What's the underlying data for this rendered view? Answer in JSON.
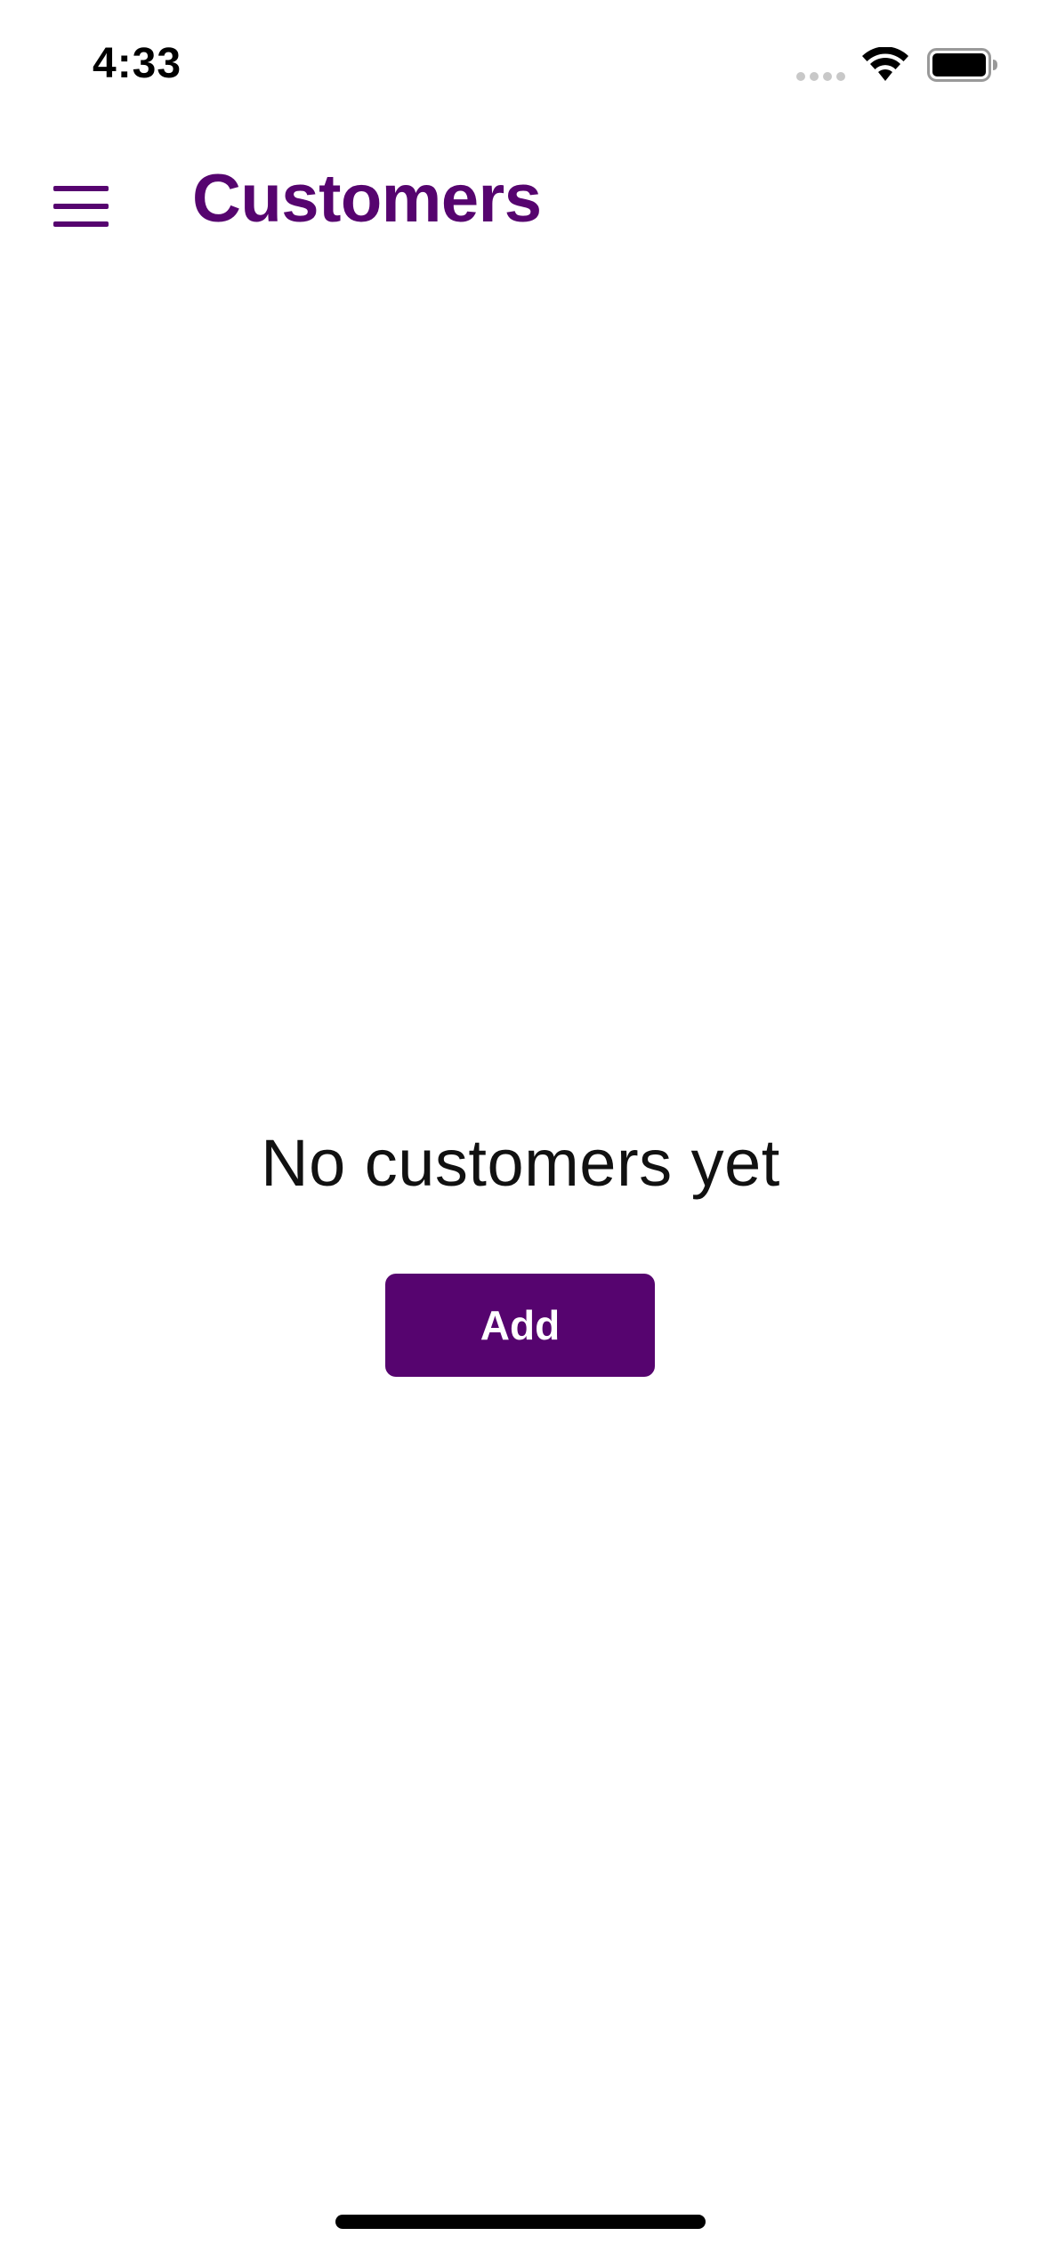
{
  "status_bar": {
    "time": "4:33",
    "icons": [
      "cellular-signal-icon",
      "wifi-icon",
      "battery-icon"
    ]
  },
  "header": {
    "title": "Customers",
    "menu_icon": "hamburger-menu-icon"
  },
  "main": {
    "empty_message": "No customers yet",
    "add_label": "Add"
  },
  "colors": {
    "accent": "#56046F",
    "text": "#111111",
    "background": "#FFFFFF"
  }
}
